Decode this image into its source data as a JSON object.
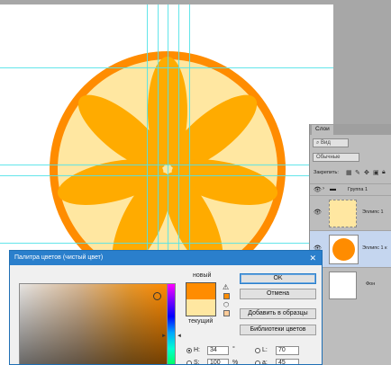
{
  "canvas": {
    "colors": {
      "rind": "#ff8c00",
      "pith": "#ffe7a1",
      "segment": "#ffab00"
    }
  },
  "layers_panel": {
    "tab": "Слои",
    "search_kind": "Вид",
    "blend_mode": "Обычные",
    "lock_label": "Закрепить:",
    "layers": [
      {
        "name": "Группа 1",
        "kind": "group"
      },
      {
        "name": "Эллипс 1",
        "kind": "shape",
        "thumb_color": "#ffe7a1"
      },
      {
        "name": "Эллипс 1 к",
        "kind": "shape",
        "thumb_color": "#ff8c00",
        "selected": true
      },
      {
        "name": "Фон",
        "kind": "background",
        "thumb_color": "#ffffff"
      }
    ]
  },
  "color_picker": {
    "title": "Палитра цветов (чистый цвет)",
    "new_label": "новый",
    "current_label": "текущий",
    "new_color": "#ff8c00",
    "current_color": "#ffe7a1",
    "buttons": {
      "ok": "OK",
      "cancel": "Отмена",
      "add_to_swatches": "Добавить в образцы",
      "color_libraries": "Библиотеки цветов"
    },
    "fields": {
      "h_label": "H:",
      "h_value": "34",
      "h_unit": "°",
      "s_label": "S:",
      "s_value": "100",
      "s_unit": "%",
      "l_label": "L:",
      "l_value": "70",
      "a_label": "a:",
      "a_value": "45"
    }
  }
}
